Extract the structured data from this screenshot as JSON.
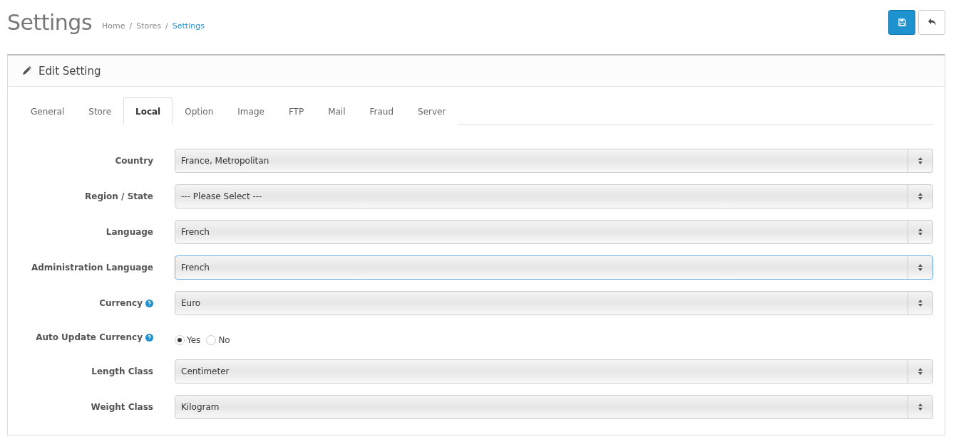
{
  "page": {
    "title": "Settings",
    "breadcrumb": [
      {
        "label": "Home",
        "current": false
      },
      {
        "separator": "/",
        "label": "Stores",
        "current": false
      },
      {
        "separator": "/",
        "label": "Settings",
        "current": true
      }
    ]
  },
  "panel": {
    "title": "Edit Setting"
  },
  "tabs": [
    {
      "label": "General",
      "selected": false
    },
    {
      "label": "Store",
      "selected": false
    },
    {
      "label": "Local",
      "selected": true
    },
    {
      "label": "Option",
      "selected": false
    },
    {
      "label": "Image",
      "selected": false
    },
    {
      "label": "FTP",
      "selected": false
    },
    {
      "label": "Mail",
      "selected": false
    },
    {
      "label": "Fraud",
      "selected": false
    },
    {
      "label": "Server",
      "selected": false
    }
  ],
  "fields": [
    {
      "kind": "select",
      "label": "Country",
      "help": false,
      "value": "France, Metropolitan",
      "focused": false
    },
    {
      "kind": "select",
      "label": "Region / State",
      "help": false,
      "value": "--- Please Select ---",
      "focused": false
    },
    {
      "kind": "select",
      "label": "Language",
      "help": false,
      "value": "French",
      "focused": false
    },
    {
      "kind": "select",
      "label": "Administration Language",
      "help": false,
      "value": "French",
      "focused": true
    },
    {
      "kind": "select",
      "label": "Currency",
      "help": true,
      "value": "Euro",
      "focused": false
    },
    {
      "kind": "radio",
      "label": "Auto Update Currency",
      "help": true,
      "options": [
        {
          "label": "Yes",
          "selected": true
        },
        {
          "label": "No",
          "selected": false
        }
      ]
    },
    {
      "kind": "select",
      "label": "Length Class",
      "help": false,
      "value": "Centimeter",
      "focused": false
    },
    {
      "kind": "select",
      "label": "Weight Class",
      "help": false,
      "value": "Kilogram",
      "focused": false
    }
  ]
}
